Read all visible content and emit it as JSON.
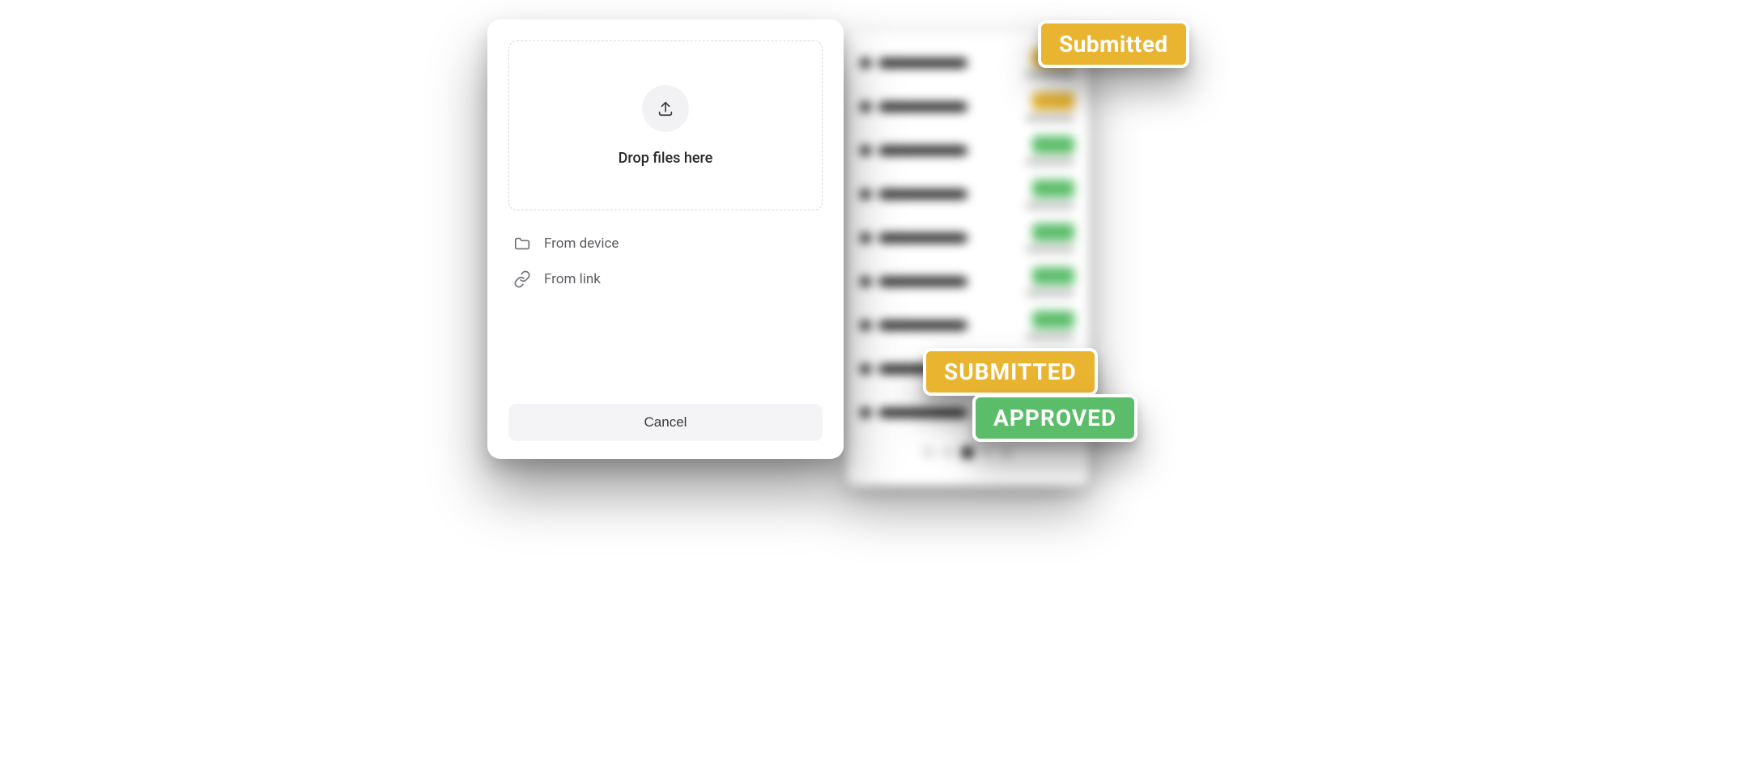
{
  "dialog": {
    "dropzone_text": "Drop files here",
    "from_device": "From device",
    "from_link": "From link",
    "cancel": "Cancel"
  },
  "callouts": {
    "submitted_title": "Submitted",
    "submitted_upper": "SUBMITTED",
    "approved_upper": "APPROVED"
  },
  "background_list": {
    "rows": [
      {
        "status": "amber"
      },
      {
        "status": "amber"
      },
      {
        "status": "green"
      },
      {
        "status": "green"
      },
      {
        "status": "green"
      },
      {
        "status": "green"
      },
      {
        "status": "green"
      },
      {
        "status": "green"
      },
      {
        "status": "green"
      }
    ]
  },
  "colors": {
    "amber": "#e9b531",
    "green": "#5bbd6a"
  }
}
